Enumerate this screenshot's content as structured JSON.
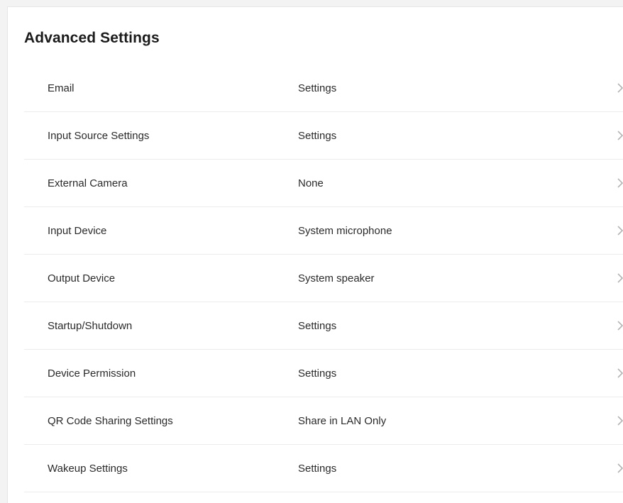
{
  "page": {
    "title": "Advanced Settings"
  },
  "settings": {
    "rows": [
      {
        "label": "Email",
        "value": "Settings"
      },
      {
        "label": "Input Source Settings",
        "value": "Settings"
      },
      {
        "label": "External Camera",
        "value": "None"
      },
      {
        "label": "Input Device",
        "value": "System microphone"
      },
      {
        "label": "Output Device",
        "value": "System speaker"
      },
      {
        "label": "Startup/Shutdown",
        "value": "Settings"
      },
      {
        "label": "Device Permission",
        "value": "Settings"
      },
      {
        "label": "QR Code Sharing Settings",
        "value": "Share in LAN Only"
      },
      {
        "label": "Wakeup Settings",
        "value": "Settings"
      }
    ]
  },
  "icons": {
    "row_chevron": "chevron-right-icon"
  },
  "colors": {
    "background": "#f3f3f3",
    "panel": "#ffffff",
    "divider": "#ececec",
    "text": "#2a2a2a",
    "chevron": "#b5b5b5"
  }
}
